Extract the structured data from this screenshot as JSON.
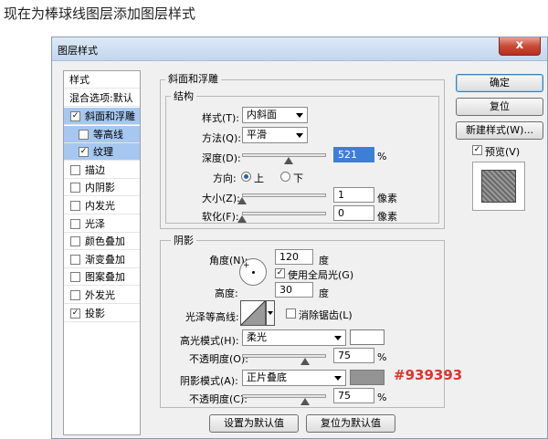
{
  "caption": "现在为棒球线图层添加图层样式",
  "dialog": {
    "title": "图层样式",
    "close_glyph": "x"
  },
  "style_list": {
    "header": "样式",
    "blend": "混合选项:默认",
    "items": [
      {
        "label": "斜面和浮雕",
        "checked": true,
        "selected": true,
        "sub": false
      },
      {
        "label": "等高线",
        "checked": false,
        "selected": true,
        "sub": true
      },
      {
        "label": "纹理",
        "checked": true,
        "selected": true,
        "sub": true
      },
      {
        "label": "描边",
        "checked": false,
        "selected": false,
        "sub": false
      },
      {
        "label": "内阴影",
        "checked": false,
        "selected": false,
        "sub": false
      },
      {
        "label": "内发光",
        "checked": false,
        "selected": false,
        "sub": false
      },
      {
        "label": "光泽",
        "checked": false,
        "selected": false,
        "sub": false
      },
      {
        "label": "颜色叠加",
        "checked": false,
        "selected": false,
        "sub": false
      },
      {
        "label": "渐变叠加",
        "checked": false,
        "selected": false,
        "sub": false
      },
      {
        "label": "图案叠加",
        "checked": false,
        "selected": false,
        "sub": false
      },
      {
        "label": "外发光",
        "checked": false,
        "selected": false,
        "sub": false
      },
      {
        "label": "投影",
        "checked": true,
        "selected": false,
        "sub": false
      }
    ]
  },
  "bevel": {
    "group_title": "斜面和浮雕",
    "structure_title": "结构",
    "style_label": "样式(T):",
    "style_value": "内斜面",
    "technique_label": "方法(Q):",
    "technique_value": "平滑",
    "depth_label": "深度(D):",
    "depth_value": "521",
    "depth_unit": "%",
    "depth_level": 0.55,
    "direction_label": "方向:",
    "dir_up": "上",
    "dir_down": "下",
    "size_label": "大小(Z):",
    "size_value": "1",
    "size_unit": "像素",
    "size_level": 0.0,
    "soften_label": "软化(F):",
    "soften_value": "0",
    "soften_unit": "像素",
    "soften_level": 0.0
  },
  "shading": {
    "title": "阴影",
    "angle_label": "角度(N):",
    "angle_value": "120",
    "angle_unit": "度",
    "global_light_label": "使用全局光(G)",
    "altitude_label": "高度:",
    "altitude_value": "30",
    "altitude_unit": "度",
    "gloss_contour_label": "光泽等高线:",
    "antialias_label": "消除锯齿(L)",
    "highlight_mode_label": "高光模式(H):",
    "highlight_mode_value": "柔光",
    "highlight_opacity_label": "不透明度(O):",
    "highlight_opacity_value": "75",
    "highlight_opacity_unit": "%",
    "highlight_opacity_level": 0.75,
    "shadow_mode_label": "阴影模式(A):",
    "shadow_mode_value": "正片叠底",
    "shadow_color": "#939393",
    "highlight_color": "#ffffff",
    "shadow_opacity_label": "不透明度(C):",
    "shadow_opacity_value": "75",
    "shadow_opacity_unit": "%",
    "shadow_opacity_level": 0.75
  },
  "footer": {
    "make_default": "设置为默认值",
    "reset_default": "复位为默认值"
  },
  "buttons": {
    "ok": "确定",
    "reset": "复位",
    "new_style": "新建样式(W)...",
    "preview": "预览(V)"
  },
  "annotation": {
    "text": "#939393",
    "color": "#e0322a"
  }
}
